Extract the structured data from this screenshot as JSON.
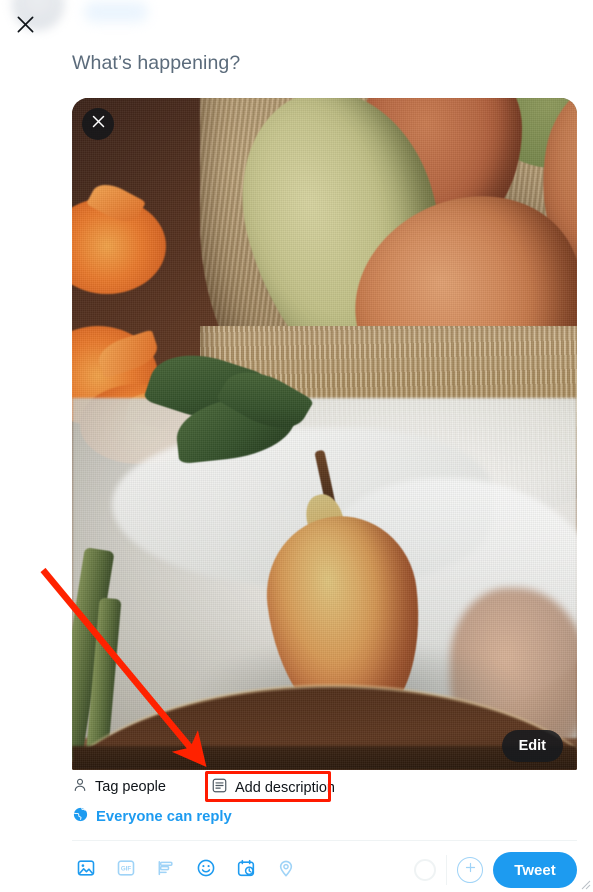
{
  "window": {
    "app": "Twitter",
    "screen": "compose-tweet"
  },
  "header": {
    "close_icon": "close-icon",
    "close_label": "Close"
  },
  "composer": {
    "placeholder": "What’s happening?",
    "text_value": ""
  },
  "media": {
    "remove_icon": "close-icon",
    "remove_label": "Remove media",
    "edit_label": "Edit",
    "alt_description": "Pears in a woven basket with orange flowers and white cloth on a wooden tray",
    "tag_people_label": "Tag people",
    "tag_people_icon": "person-icon",
    "add_description_label": "Add description",
    "add_description_icon": "alt-text-icon"
  },
  "annotation": {
    "highlight_target": "Add description",
    "highlight_color": "#ff1a00",
    "arrow_color": "#ff2200"
  },
  "reply_scope": {
    "label": "Everyone can reply",
    "icon": "globe-icon",
    "color": "#1d9bf0"
  },
  "toolbar": {
    "items": [
      {
        "name": "media-icon",
        "label": "Media",
        "enabled": true
      },
      {
        "name": "gif-icon",
        "label": "GIF",
        "enabled": false
      },
      {
        "name": "poll-icon",
        "label": "Poll",
        "enabled": false
      },
      {
        "name": "emoji-icon",
        "label": "Emoji",
        "enabled": true
      },
      {
        "name": "schedule-icon",
        "label": "Schedule",
        "enabled": true
      },
      {
        "name": "location-icon",
        "label": "Location",
        "enabled": true
      }
    ],
    "gif_text": "GIF",
    "progress_label": "",
    "add_thread_label": "Add another Tweet",
    "tweet_label": "Tweet"
  },
  "colors": {
    "accent": "#1d9bf0",
    "accent_disabled": "#9fd3f7",
    "text": "#0f1419",
    "placeholder": "#5b6b7b",
    "divider": "#eff3f4",
    "annotation_red": "#ff1a00"
  }
}
